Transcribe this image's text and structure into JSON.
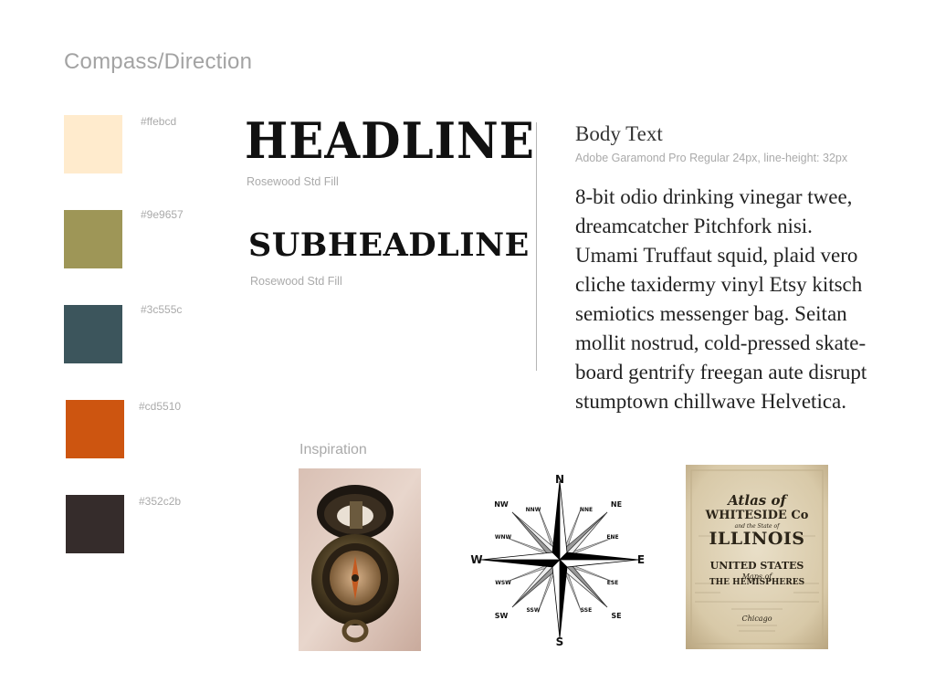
{
  "page": {
    "title": "Compass/Direction"
  },
  "palette": {
    "swatches": [
      {
        "hex": "#ffebcd",
        "label": "#ffebcd"
      },
      {
        "hex": "#9e9657",
        "label": "#9e9657"
      },
      {
        "hex": "#3c555c",
        "label": "#3c555c"
      },
      {
        "hex": "#cd5510",
        "label": "#cd5510"
      },
      {
        "hex": "#352c2b",
        "label": "#352c2b"
      }
    ]
  },
  "typography": {
    "headline": {
      "sample": "HEADLINE",
      "font": "Rosewood Std Fill"
    },
    "subheadline": {
      "sample": "SUBHEADLINE",
      "font": "Rosewood Std Fill"
    },
    "body": {
      "title": "Body Text",
      "spec": "Adobe Garamond Pro Regular 24px, line-height: 32px",
      "lines": [
        "8-bit odio drinking vinegar twee,",
        "dreamcatcher Pitchfork nisi.",
        "Umami Truffaut squid, plaid vero",
        "cliche taxidermy vinyl Etsy kitsch",
        "semiotics messenger bag. Seitan",
        "mollit nostrud, cold-pressed skate-",
        "board gentrify freegan aute disrupt",
        "stumptown chillwave Helvetica."
      ]
    }
  },
  "inspiration": {
    "title": "Inspiration",
    "compass_rose": {
      "cardinals": [
        "N",
        "E",
        "S",
        "W"
      ],
      "intercardinals": [
        "NE",
        "SE",
        "SW",
        "NW"
      ],
      "minor": [
        "NNE",
        "ENE",
        "ESE",
        "SSE",
        "SSW",
        "WSW",
        "WNW",
        "NNW"
      ]
    },
    "atlas": {
      "lines": [
        "Atlas of",
        "WHITESIDE Co",
        "and the State of",
        "ILLINOIS",
        "UNITED STATES",
        "Maps of",
        "THE HEMISPHERES",
        "Chicago"
      ]
    }
  }
}
